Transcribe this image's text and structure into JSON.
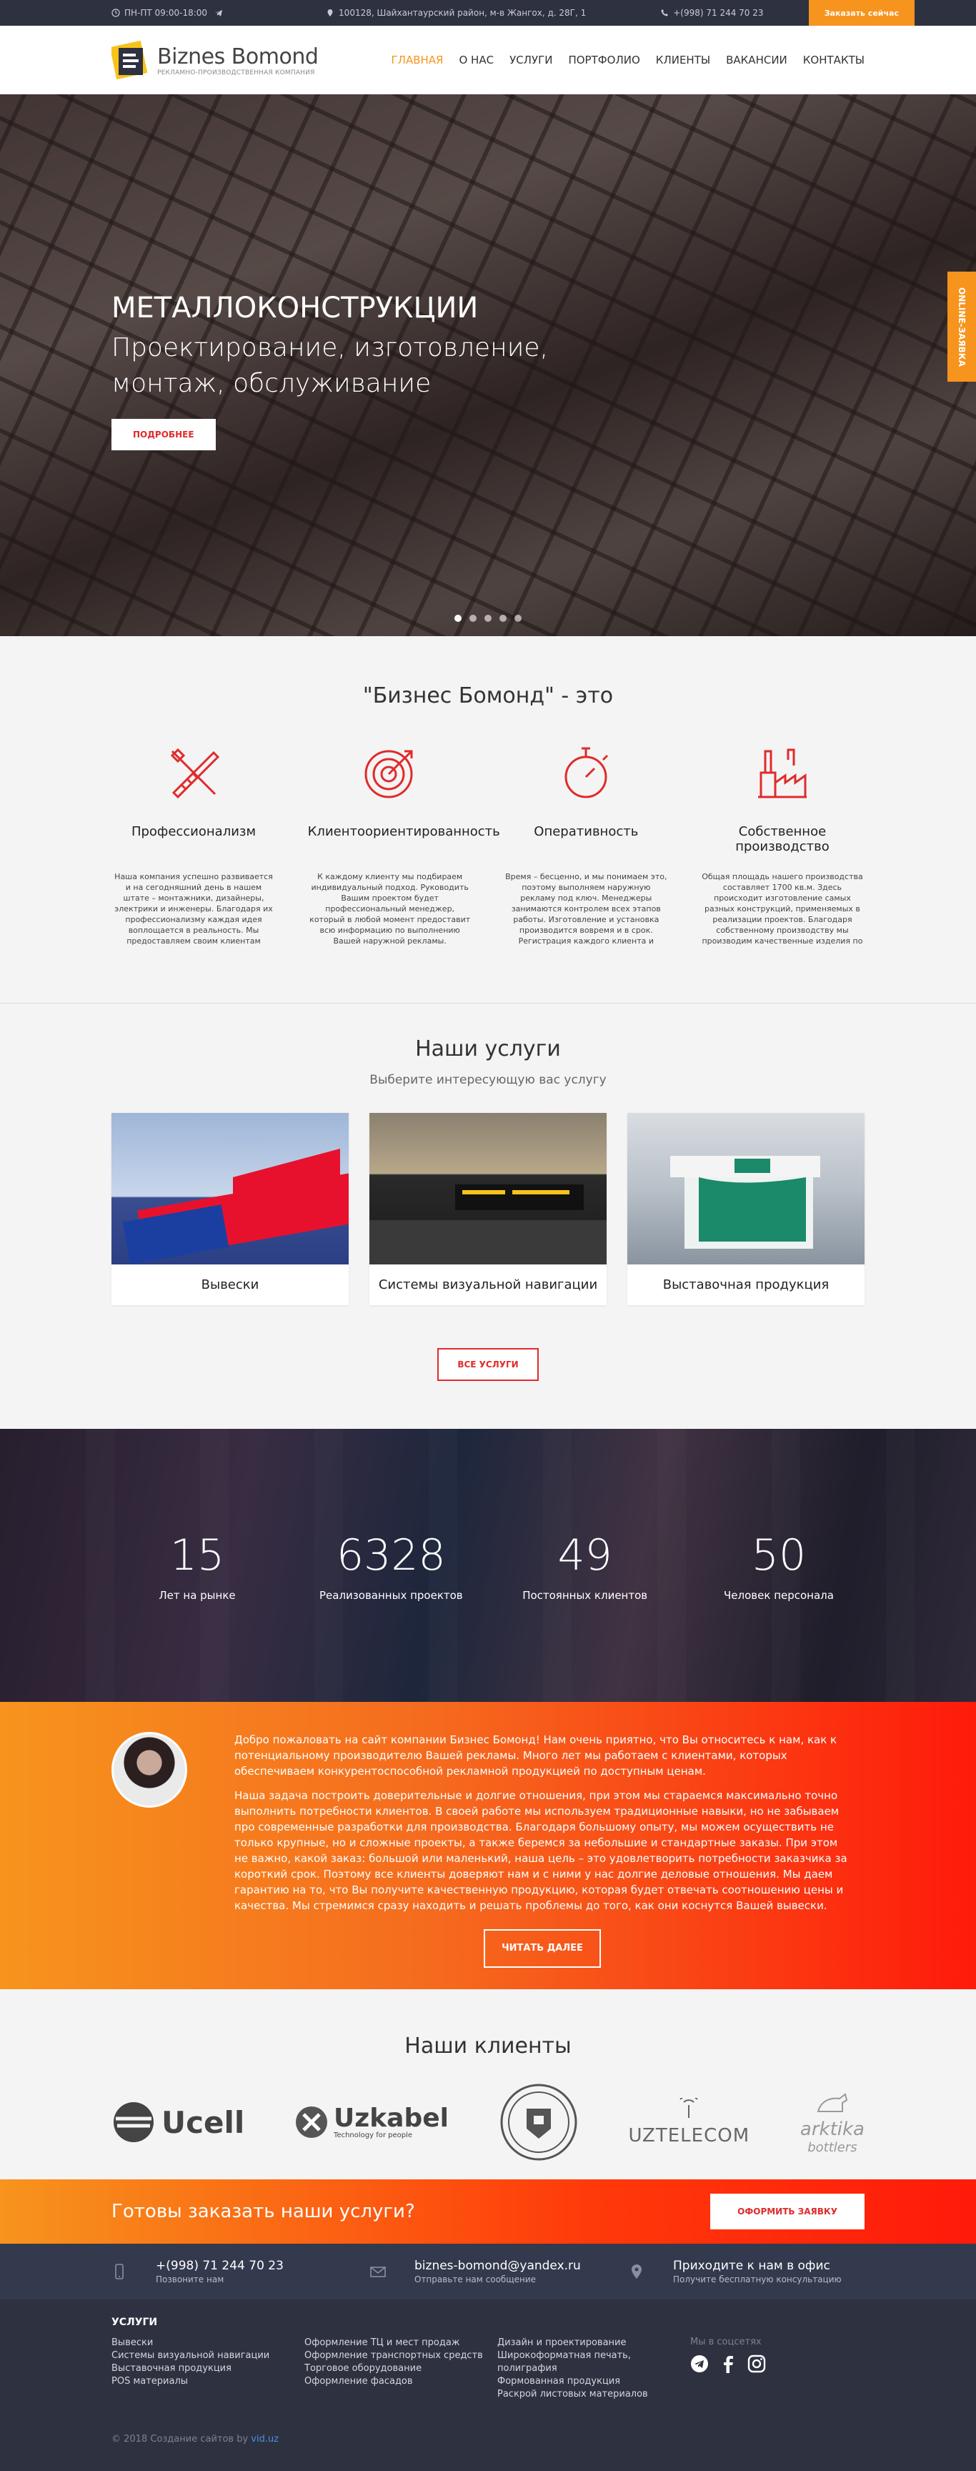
{
  "topbar": {
    "hours": "ПН-ПТ 09:00-18:00",
    "address": "100128, Шайхантаурский район, м-в Жангох, д. 28Г, 1",
    "phone": "+(998) 71 244 70 23",
    "order_button": "Заказать сейчас"
  },
  "header": {
    "logo_name": "Biznes Bomond",
    "logo_sub": "РЕКЛАМНО-ПРОИЗВОДСТВЕННАЯ КОМПАНИЯ",
    "nav": [
      "ГЛАВНАЯ",
      "О НАС",
      "УСЛУГИ",
      "ПОРТФОЛИО",
      "КЛИЕНТЫ",
      "ВАКАНСИИ",
      "КОНТАКТЫ"
    ]
  },
  "hero": {
    "title": "МЕТАЛЛОКОНСТРУКЦИИ",
    "subtitle": "Проектирование, изготовление, монтаж, обслуживание",
    "button": "ПОДРОБНЕЕ",
    "online_tab": "ONLINE-ЗАЯВКА",
    "slides_count": 5,
    "active_slide": 1
  },
  "about": {
    "title": "\"Бизнес Бомонд\" - это",
    "features": [
      {
        "icon": "tools-icon",
        "title": "Профессионализм",
        "text": "Наша компания успешно развивается и на сегодняшний день в нашем штате – монтажники, дизайнеры, электрики и инженеры. Благодаря их профессионализму каждая идея воплощается в реальность. Мы предоставляем своим клиентам"
      },
      {
        "icon": "target-icon",
        "title": "Клиентоориентированность",
        "text": "К каждому клиенту мы подбираем индивидуальный подход. Руководить Вашим проектом будет профессиональный менеджер, который в любой момент предоставит всю информацию по выполнению Вашей наружной рекламы."
      },
      {
        "icon": "stopwatch-icon",
        "title": "Оперативность",
        "text": "Время – бесценно, и мы понимаем это, поэтому выполняем наружную рекламу под ключ. Менеджеры занимаются контролем всех этапов работы. Изготовление и установка производится вовремя и в срок. Регистрация каждого клиента и согласование проекта"
      },
      {
        "icon": "factory-icon",
        "title": "Собственное производство",
        "text": "Общая площадь нашего производства составляет 1700 кв.м. Здесь происходит изготовление самых разных конструкций, применяемых в реализации проектов. Благодаря собственному производству мы производим качественные изделия по"
      }
    ]
  },
  "services": {
    "title": "Наши услуги",
    "subtitle": "Выберите интересующую вас услугу",
    "cards": [
      {
        "title": "Вывески"
      },
      {
        "title": "Системы визуальной навигации"
      },
      {
        "title": "Выставочная продукция"
      }
    ],
    "all_button": "ВСЕ УСЛУГИ"
  },
  "stats": [
    {
      "num": "15",
      "label": "Лет на рынке"
    },
    {
      "num": "6328",
      "label": "Реализованных проектов"
    },
    {
      "num": "49",
      "label": "Постоянных клиентов"
    },
    {
      "num": "50",
      "label": "Человек персонала"
    }
  ],
  "welcome": {
    "p1": "Добро пожаловать на сайт компании Бизнес Бомонд! Нам очень приятно, что Вы относитесь к нам, как к потенциальному производителю Вашей рекламы. Много лет мы работаем с клиентами, которых обеспечиваем конкурентоспособной рекламной продукцией по доступным ценам.",
    "p2": "Наша задача построить доверительные и долгие отношения, при этом мы стараемся максимально точно выполнить потребности клиентов. В своей работе мы используем традиционные навыки, но не забываем про современные разработки для производства. Благодаря большому опыту, мы можем осуществить не только крупные, но и сложные проекты, а также беремся за небольшие и стандартные заказы. При этом не важно, какой заказ: большой или маленький, наша цель – это удовлетворить потребности заказчика за короткий срок. Поэтому все клиенты доверяют нам и с ними у нас долгие деловые отношения. Мы даем гарантию на то, что Вы получите качественную продукцию, которая будет отвечать соотношению цены и качества. Мы стремимся сразу находить и решать проблемы до того, как они коснутся Вашей вывески.",
    "button": "ЧИТАТЬ ДАЛЕЕ"
  },
  "clients": {
    "title": "Наши клиенты",
    "logos": [
      "Ucell",
      "Uzkabel",
      "Technology for people",
      "UZTELECOM",
      "arktika",
      "bottlers"
    ]
  },
  "order": {
    "title": "Готовы заказать наши услуги?",
    "button": "ОФОРМИТЬ ЗАЯВКУ"
  },
  "contacts": [
    {
      "icon": "phone-icon",
      "main": "+(998) 71 244 70 23",
      "sub": "Позвоните нам"
    },
    {
      "icon": "mail-icon",
      "main": "biznes-bomond@yandex.ru",
      "sub": "Отправьте нам сообщение"
    },
    {
      "icon": "map-pin-icon",
      "main": "Приходите к нам в офис",
      "sub": "Получите бесплатную консультацию"
    }
  ],
  "footer": {
    "heading": "УСЛУГИ",
    "col1": [
      "Вывески",
      "Системы визуальной навигации",
      "Выставочная продукция",
      "POS материалы"
    ],
    "col2": [
      "Оформление ТЦ и мест продаж",
      "Оформление транспортных средств",
      "Торговое оборудование",
      "Оформление фасадов"
    ],
    "col3": [
      "Дизайн и проектирование",
      "Широкоформатная печать, полиграфия",
      "Формованная продукция",
      "Раскрой листовых материалов"
    ],
    "social_label": "Мы в соцсетях",
    "copyright": "© 2018 Создание сайтов by ",
    "copyright_link": "vid.uz"
  },
  "colors": {
    "accent": "#f7941d",
    "red": "#e02b2b",
    "dark": "#2e3140"
  }
}
